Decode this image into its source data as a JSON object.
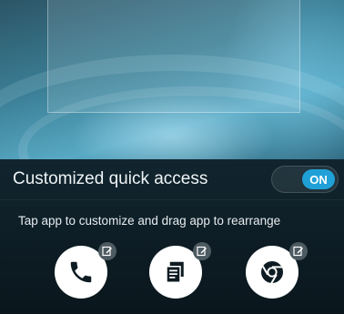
{
  "quick_access": {
    "title": "Customized quick access",
    "toggle_state": "ON",
    "hint": "Tap app to customize and drag app to rearrange"
  },
  "apps": [
    {
      "icon": "phone-icon",
      "badge_icon": "edit-icon"
    },
    {
      "icon": "notes-icon",
      "badge_icon": "edit-icon"
    },
    {
      "icon": "chrome-icon",
      "badge_icon": "edit-icon"
    }
  ],
  "colors": {
    "accent": "#1fa1d8",
    "panel": "#122630",
    "app_glyph": "#0e1b22",
    "badge": "#4d5a61"
  }
}
